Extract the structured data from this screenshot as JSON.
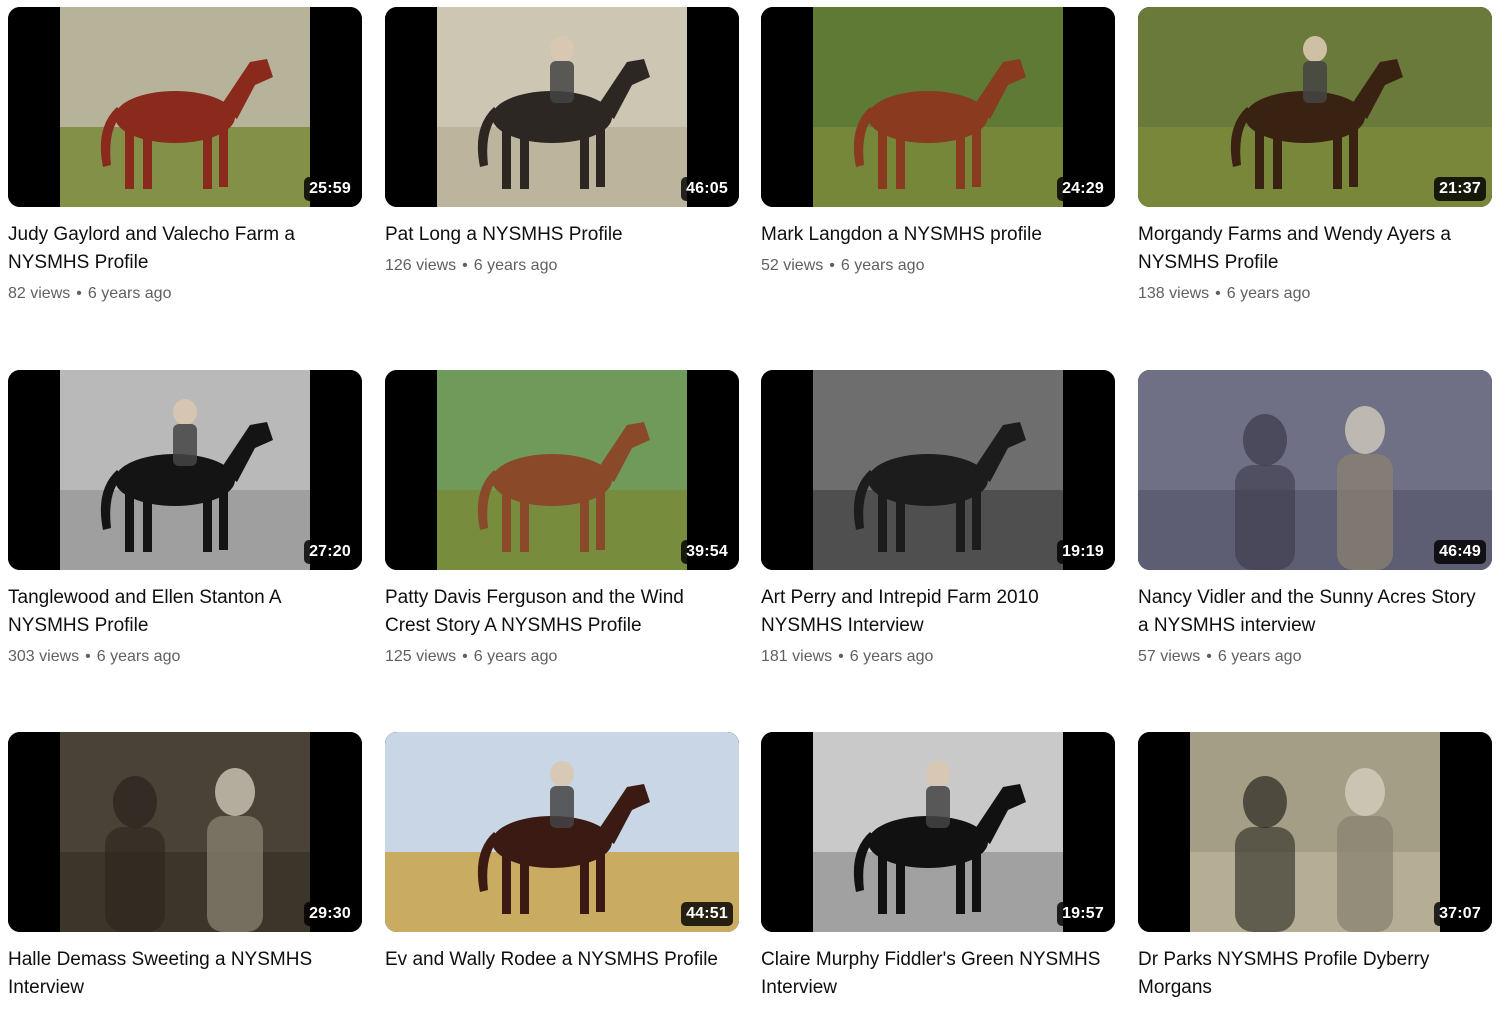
{
  "videos": [
    {
      "title": "Judy Gaylord and Valecho Farm a NYSMHS Profile",
      "duration": "25:59",
      "views": "82 views",
      "age": "6 years ago",
      "thumb": "color-field",
      "bg": "#b7b39a",
      "horse": "#8a2a1c"
    },
    {
      "title": "Pat Long a NYSMHS Profile",
      "duration": "46:05",
      "views": "126 views",
      "age": "6 years ago",
      "thumb": "sepia",
      "bg": "#cdc6b2",
      "horse": "#2c2722"
    },
    {
      "title": "Mark Langdon a NYSMHS profile",
      "duration": "24:29",
      "views": "52 views",
      "age": "6 years ago",
      "thumb": "color-pasture",
      "bg": "#5e7a35",
      "horse": "#8a3a1e"
    },
    {
      "title": "Morgandy Farms and Wendy Ayers a NYSMHS Profile",
      "duration": "21:37",
      "views": "138 views",
      "age": "6 years ago",
      "thumb": "color-night",
      "bg": "#6a7a3a",
      "horse": "#3a2212"
    },
    {
      "title": "Tanglewood and Ellen Stanton A NYSMHS Profile",
      "duration": "27:20",
      "views": "303 views",
      "age": "6 years ago",
      "thumb": "bw",
      "bg": "#b9b9b9",
      "horse": "#141414"
    },
    {
      "title": "Patty Davis Ferguson and the Wind Crest Story A NYSMHS Profile",
      "duration": "39:54",
      "views": "125 views",
      "age": "6 years ago",
      "thumb": "color-field",
      "bg": "#6f9a5a",
      "horse": "#8a4a2a"
    },
    {
      "title": "Art Perry and Intrepid Farm 2010 NYSMHS Interview",
      "duration": "19:19",
      "views": "181 views",
      "age": "6 years ago",
      "thumb": "bw-studio",
      "bg": "#6e6e6e",
      "horse": "#1c1c1c"
    },
    {
      "title": "Nancy Vidler and the Sunny Acres Story a NYSMHS interview",
      "duration": "46:49",
      "views": "57 views",
      "age": "6 years ago",
      "thumb": "people",
      "bg": "#6f6f86",
      "horse": "#3a3a4a"
    },
    {
      "title": "Halle Demass Sweeting a NYSMHS Interview",
      "duration": "29:30",
      "views": "",
      "age": "",
      "thumb": "room",
      "bg": "#4a4236",
      "horse": "#2a241c"
    },
    {
      "title": "Ev and Wally Rodee a NYSMHS Profile",
      "duration": "44:51",
      "views": "",
      "age": "",
      "thumb": "color-sky",
      "bg": "#c8d6e6",
      "horse": "#3a1a12"
    },
    {
      "title": "Claire Murphy Fiddler's Green NYSMHS Interview",
      "duration": "19:57",
      "views": "",
      "age": "",
      "thumb": "bw-show",
      "bg": "#c9c9c9",
      "horse": "#111111"
    },
    {
      "title": "Dr Parks NYSMHS Profile Dyberry Morgans",
      "duration": "37:07",
      "views": "",
      "age": "",
      "thumb": "sepia-people",
      "bg": "#a49e86",
      "horse": "#2a2620"
    }
  ],
  "meta_separator": "•"
}
